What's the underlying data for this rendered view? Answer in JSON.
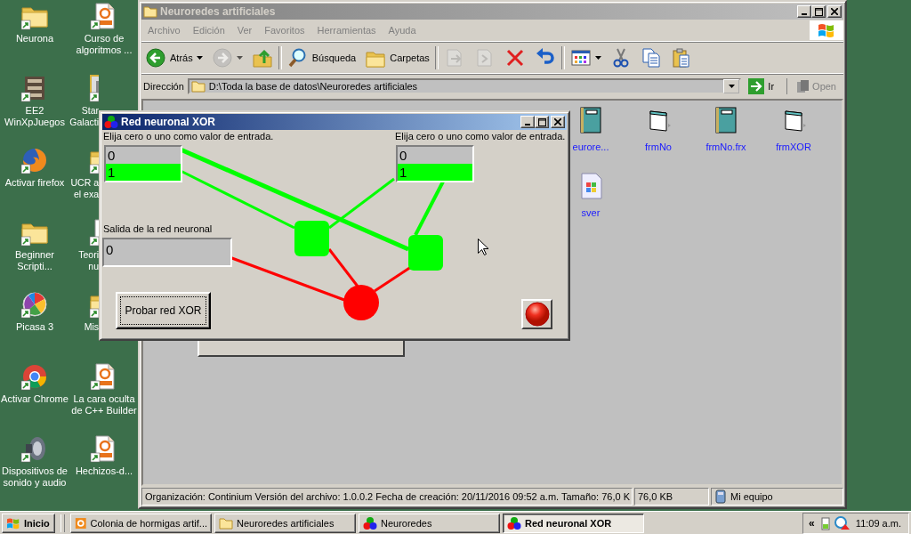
{
  "desktop_icons": [
    {
      "label": "Neurona",
      "kind": "folder",
      "cut": false
    },
    {
      "label": "EE2 WinXpJuegos",
      "kind": "game",
      "cut": false
    },
    {
      "label": "Activar firefox",
      "kind": "firefox",
      "cut": false
    },
    {
      "label": "Beginner Scripti...",
      "kind": "folder",
      "cut": false
    },
    {
      "label": "Picasa 3",
      "kind": "picasa",
      "cut": false
    },
    {
      "label": "Activar Chrome",
      "kind": "chrome",
      "cut": false
    },
    {
      "label": "Dispositivos de sonido y audio",
      "kind": "speaker",
      "cut": false
    },
    {
      "label": "Curso de algoritmos ...",
      "kind": "pdf",
      "cut": false
    },
    {
      "label": "Star Galacti",
      "kind": "image",
      "cut": true
    },
    {
      "label": "UCR a el exa",
      "kind": "folder",
      "cut": true
    },
    {
      "label": "Teori nu",
      "kind": "doc",
      "cut": true
    },
    {
      "label": "Mis",
      "kind": "folder",
      "cut": true
    },
    {
      "label": "La cara oculta de C++ Builder",
      "kind": "pdf",
      "cut": false
    },
    {
      "label": "Hechizos-d...",
      "kind": "pdf",
      "cut": false
    }
  ],
  "explorer": {
    "title": "Neuroredes artificiales",
    "menu": [
      "Archivo",
      "Edición",
      "Ver",
      "Favoritos",
      "Herramientas",
      "Ayuda"
    ],
    "toolbar": [
      [
        {
          "kind": "back",
          "label": "Atrás",
          "disabled": false
        },
        {
          "kind": "forward",
          "disabled": true
        },
        {
          "kind": "up",
          "disabled": false
        }
      ],
      [
        {
          "kind": "search",
          "label": "Búsqueda",
          "disabled": false
        },
        {
          "kind": "folders",
          "label": "Carpetas",
          "disabled": false
        }
      ],
      [
        {
          "kind": "move",
          "disabled": true
        },
        {
          "kind": "copyto",
          "disabled": true
        },
        {
          "kind": "delete",
          "disabled": false
        },
        {
          "kind": "undo",
          "disabled": false
        }
      ],
      [
        {
          "kind": "views",
          "disabled": false
        },
        {
          "kind": "cut",
          "disabled": false
        },
        {
          "kind": "copy",
          "disabled": false
        },
        {
          "kind": "paste",
          "disabled": false
        }
      ]
    ],
    "address": {
      "label": "Dirección",
      "path": "D:\\Toda la base de datos\\Neuroredes artificiales",
      "go": "Ir",
      "open": {
        "label": "Open",
        "disabled": true
      }
    },
    "files": [
      {
        "name": "eurore...",
        "kind": "book"
      },
      {
        "name": "frmNo",
        "kind": "form"
      },
      {
        "name": "frmNo.frx",
        "kind": "book"
      },
      {
        "name": "frmXOR",
        "kind": "form"
      },
      {
        "name": "sver",
        "kind": "exe"
      }
    ],
    "status_bar": [
      "Organización: Continium Versión del archivo: 1.0.0.2 Fecha de creación: 20/11/2016 09:52 a.m. Tamaño: 76,0 K",
      "76,0 KB",
      "Mi equipo"
    ]
  },
  "dialog": {
    "title": "Red neuronal XOR",
    "inputs": [
      {
        "label": "Elija cero o uno como valor de entrada.",
        "options": [
          {
            "text": "0",
            "selected": false
          },
          {
            "text": "1",
            "selected": true
          }
        ]
      },
      {
        "label": "Elija cero o uno como valor de entrada.",
        "options": [
          {
            "text": "0",
            "selected": false
          },
          {
            "text": "1",
            "selected": true
          }
        ]
      }
    ],
    "output": {
      "label": "Salida de la red neuronal",
      "value": "0"
    },
    "button": "Probar red XOR",
    "network": {
      "nodes": [
        {
          "kind": "hidden",
          "color": "#00ff00"
        },
        {
          "kind": "hidden",
          "color": "#00ff00"
        },
        {
          "kind": "output",
          "color": "#ff0000"
        }
      ],
      "connections": [
        {
          "color": "#00ff00"
        },
        {
          "color": "#00ff00"
        },
        {
          "color": "#00ff00"
        },
        {
          "color": "#00ff00"
        },
        {
          "color": "#ff0000"
        },
        {
          "color": "#ff0000"
        },
        {
          "color": "#ff0000"
        }
      ]
    }
  },
  "taskbar": {
    "start": "Inicio",
    "tasks": [
      {
        "label": "Colonia de hormigas artif...",
        "kind": "pdf",
        "selected": false
      },
      {
        "label": "Neuroredes artificiales",
        "kind": "folder",
        "selected": false
      },
      {
        "label": "Neuroredes",
        "kind": "app",
        "selected": false
      },
      {
        "label": "Red neuronal XOR",
        "kind": "app",
        "selected": true
      }
    ],
    "tray_toggle": "«",
    "time": "11:09 a.m."
  }
}
